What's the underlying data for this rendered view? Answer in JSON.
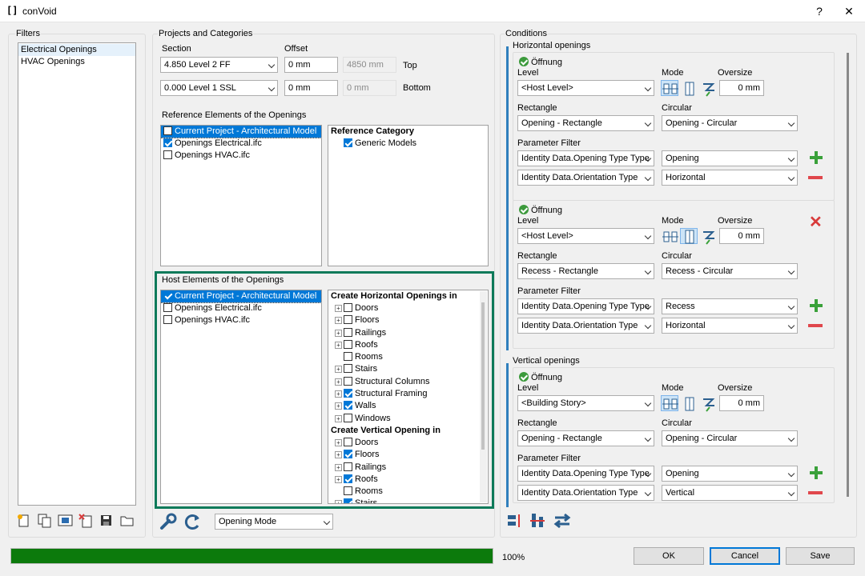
{
  "window": {
    "title": "conVoid",
    "help": "?",
    "close": "✕"
  },
  "filters": {
    "label": "Filters",
    "items": [
      "Electrical Openings",
      "HVAC Openings"
    ],
    "toolbar": [
      "new-filter-icon",
      "copy-filter-icon",
      "rename-filter-icon",
      "delete-filter-icon",
      "save-icon",
      "folder-icon"
    ]
  },
  "projects": {
    "label": "Projects and Categories",
    "section_label": "Section",
    "offset_label": "Offset",
    "top": {
      "section": "4.850  Level 2 FF",
      "offset": "0 mm",
      "computed": "4850 mm",
      "label": "Top"
    },
    "bottom": {
      "section": "0.000  Level 1 SSL",
      "offset": "0 mm",
      "computed": "0 mm",
      "label": "Bottom"
    },
    "reference_label": "Reference Elements of the Openings",
    "reference_models": [
      {
        "name": "Current Project - Architectural Model",
        "checked": false,
        "selected": true
      },
      {
        "name": "Openings Electrical.ifc",
        "checked": true,
        "selected": false
      },
      {
        "name": "Openings HVAC.ifc",
        "checked": false,
        "selected": false
      }
    ],
    "reference_category_head": "Reference Category",
    "reference_categories": [
      {
        "name": "Generic Models",
        "checked": true
      }
    ],
    "host_label": "Host Elements of the Openings",
    "host_models": [
      {
        "name": "Current Project - Architectural Model",
        "checked": true,
        "selected": true
      },
      {
        "name": "Openings Electrical.ifc",
        "checked": false,
        "selected": false
      },
      {
        "name": "Openings HVAC.ifc",
        "checked": false,
        "selected": false
      }
    ],
    "horizontal_head": "Create Horizontal Openings in",
    "horizontal_categories": [
      {
        "name": "Doors",
        "checked": false,
        "expandable": true
      },
      {
        "name": "Floors",
        "checked": false,
        "expandable": true
      },
      {
        "name": "Railings",
        "checked": false,
        "expandable": true
      },
      {
        "name": "Roofs",
        "checked": false,
        "expandable": true
      },
      {
        "name": "Rooms",
        "checked": false,
        "expandable": false
      },
      {
        "name": "Stairs",
        "checked": false,
        "expandable": true
      },
      {
        "name": "Structural Columns",
        "checked": false,
        "expandable": true
      },
      {
        "name": "Structural Framing",
        "checked": true,
        "expandable": true
      },
      {
        "name": "Walls",
        "checked": true,
        "expandable": true
      },
      {
        "name": "Windows",
        "checked": false,
        "expandable": true
      }
    ],
    "vertical_head": "Create Vertical Opening in",
    "vertical_categories": [
      {
        "name": "Doors",
        "checked": false,
        "expandable": true
      },
      {
        "name": "Floors",
        "checked": true,
        "expandable": true
      },
      {
        "name": "Railings",
        "checked": false,
        "expandable": true
      },
      {
        "name": "Roofs",
        "checked": true,
        "expandable": true
      },
      {
        "name": "Rooms",
        "checked": false,
        "expandable": false
      },
      {
        "name": "Stairs",
        "checked": true,
        "expandable": true
      }
    ],
    "mode_select": "Opening Mode"
  },
  "conditions": {
    "label": "Conditions",
    "horizontal_label": "Horizontal openings",
    "vertical_label": "Vertical openings",
    "field_labels": {
      "level": "Level",
      "mode": "Mode",
      "oversize": "Oversize",
      "rectangle": "Rectangle",
      "circular": "Circular",
      "param_filter": "Parameter Filter"
    },
    "horizontal_rules": [
      {
        "name": "Öffnung",
        "level": "<Host Level>",
        "oversize": "0 mm",
        "rectangle": "Opening - Rectangle",
        "circular": "Opening - Circular",
        "param1": "Identity Data.Opening Type Type",
        "value1": "Opening",
        "param2": "Identity Data.Orientation Type",
        "value2": "Horizontal",
        "removable": false
      },
      {
        "name": "Öffnung",
        "level": "<Host Level>",
        "oversize": "0 mm",
        "rectangle": "Recess - Rectangle",
        "circular": "Recess - Circular",
        "param1": "Identity Data.Opening Type Type",
        "value1": "Recess",
        "param2": "Identity Data.Orientation Type",
        "value2": "Horizontal",
        "removable": true
      }
    ],
    "vertical_rules": [
      {
        "name": "Öffnung",
        "level": "<Building Story>",
        "oversize": "0 mm",
        "rectangle": "Opening - Rectangle",
        "circular": "Opening - Circular",
        "param1": "Identity Data.Opening Type Type",
        "value1": "Opening",
        "param2": "Identity Data.Orientation Type",
        "value2": "Vertical"
      }
    ]
  },
  "footer": {
    "progress": 1.0,
    "progress_text": "100%",
    "ok": "OK",
    "cancel": "Cancel",
    "save": "Save"
  },
  "colors": {
    "accent": "#0078d7",
    "highlight_border": "#0e7a5a",
    "progress": "#0c7a0c",
    "add": "#3aa13a",
    "remove": "#e0474c"
  }
}
